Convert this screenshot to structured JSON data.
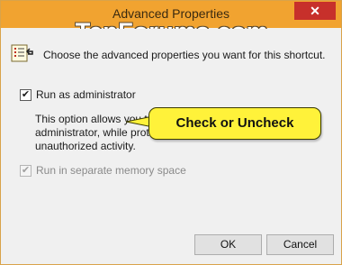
{
  "window": {
    "title": "Advanced Properties",
    "close_glyph": "✕",
    "watermark": "TenForums.com",
    "accent_color": "#f1a330"
  },
  "intro": {
    "icon": "shortcut-properties-icon",
    "text": "Choose the advanced properties you want for this shortcut."
  },
  "options": {
    "run_as_admin": {
      "label": "Run as administrator",
      "checked": true,
      "check_glyph": "✔",
      "description": "This option allows you to run this shortcut as an administrator, while protecting your computer from unauthorized activity."
    },
    "separate_memory": {
      "label": "Run in separate memory space",
      "checked": true,
      "disabled": true,
      "check_glyph": "✔"
    }
  },
  "callout": {
    "text": "Check or Uncheck",
    "color": "#fff23a"
  },
  "buttons": {
    "ok": "OK",
    "cancel": "Cancel"
  }
}
